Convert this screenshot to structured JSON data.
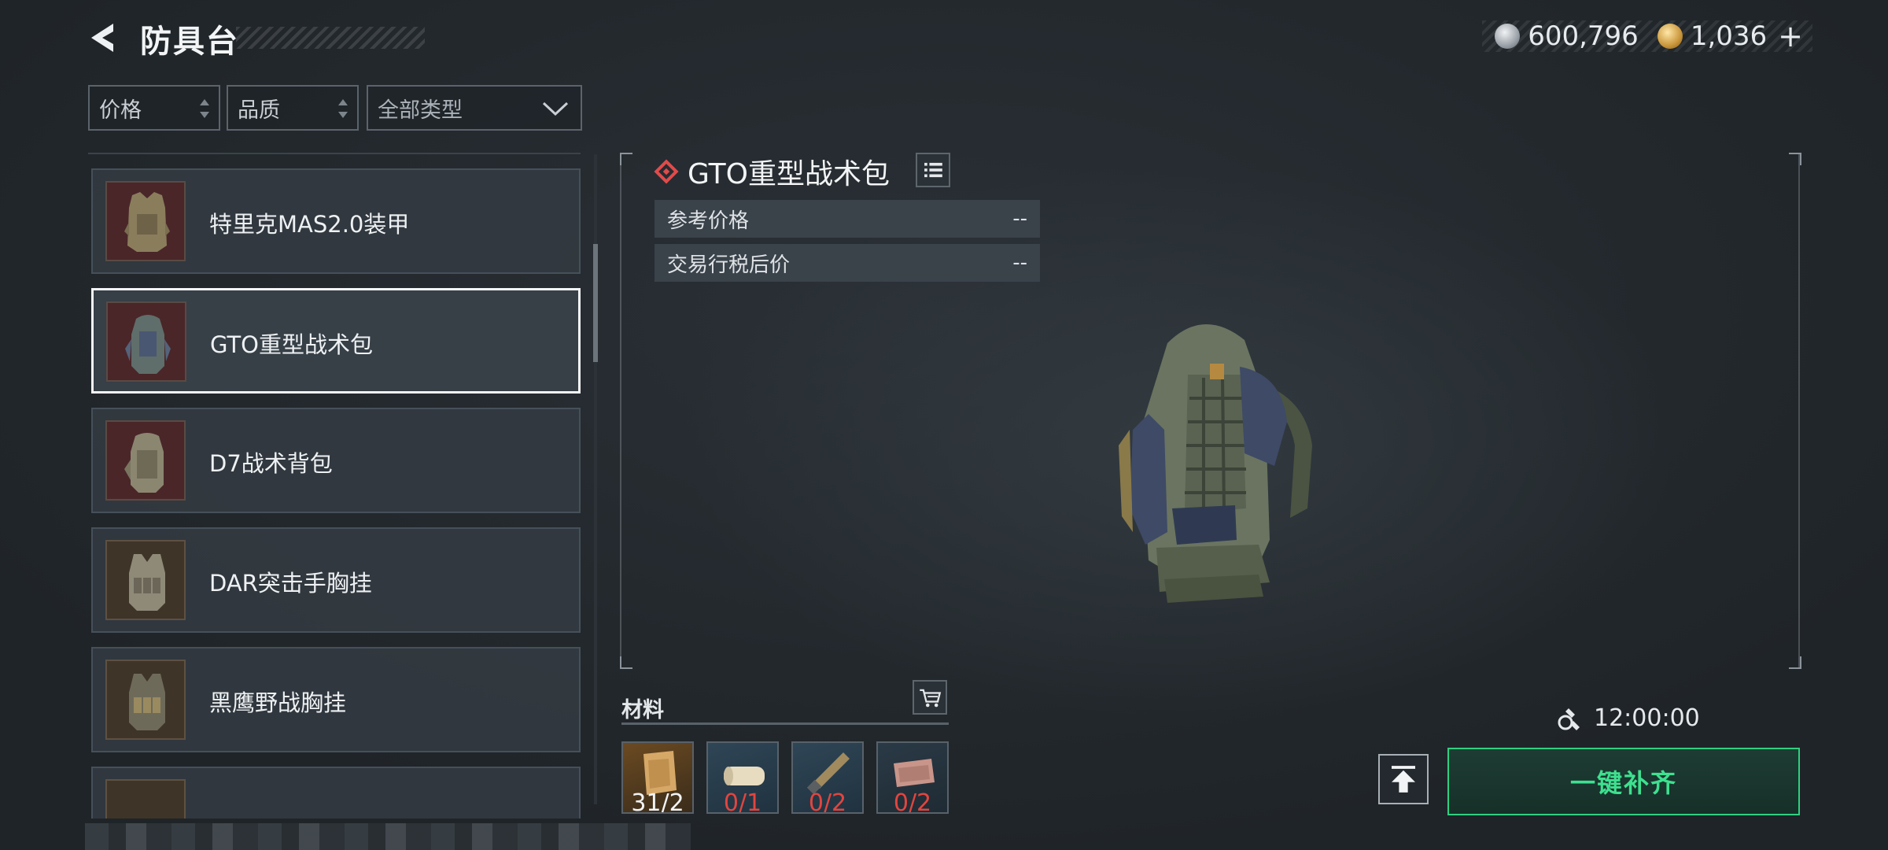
{
  "header": {
    "title": "防具台",
    "currency_silver": "600,796",
    "currency_gold": "1,036",
    "currency_plus": "+"
  },
  "filters": {
    "price": "价格",
    "quality": "品质",
    "type": "全部类型"
  },
  "items": [
    {
      "name": "特里克MAS2.0装甲",
      "thumb": "armor-icon",
      "bg": "red"
    },
    {
      "name": "GTO重型战术包",
      "thumb": "backpack-icon",
      "bg": "red",
      "selected": true
    },
    {
      "name": "D7战术背包",
      "thumb": "backpack-icon",
      "bg": "red"
    },
    {
      "name": "DAR突击手胸挂",
      "thumb": "chest-rig-icon",
      "bg": "brown"
    },
    {
      "name": "黑鹰野战胸挂",
      "thumb": "chest-rig-icon",
      "bg": "brown"
    }
  ],
  "detail": {
    "title": "GTO重型战术包",
    "ref_price_label": "参考价格",
    "ref_price_value": "--",
    "after_tax_label": "交易行税后价",
    "after_tax_value": "--"
  },
  "materials": {
    "label": "材料",
    "items": [
      {
        "count": "31/2",
        "insufficient": false,
        "icon": "fabric-icon"
      },
      {
        "count": "0/1",
        "insufficient": true,
        "icon": "roll-icon"
      },
      {
        "count": "0/2",
        "insufficient": true,
        "icon": "tool-icon"
      },
      {
        "count": "0/2",
        "insufficient": true,
        "icon": "pad-icon"
      }
    ]
  },
  "craft": {
    "time": "12:00:00",
    "refill_label": "一键补齐"
  },
  "colors": {
    "accent_green": "#3ee08f",
    "insufficient_red": "#e2453f",
    "rarity_red": "#e04b4b"
  }
}
